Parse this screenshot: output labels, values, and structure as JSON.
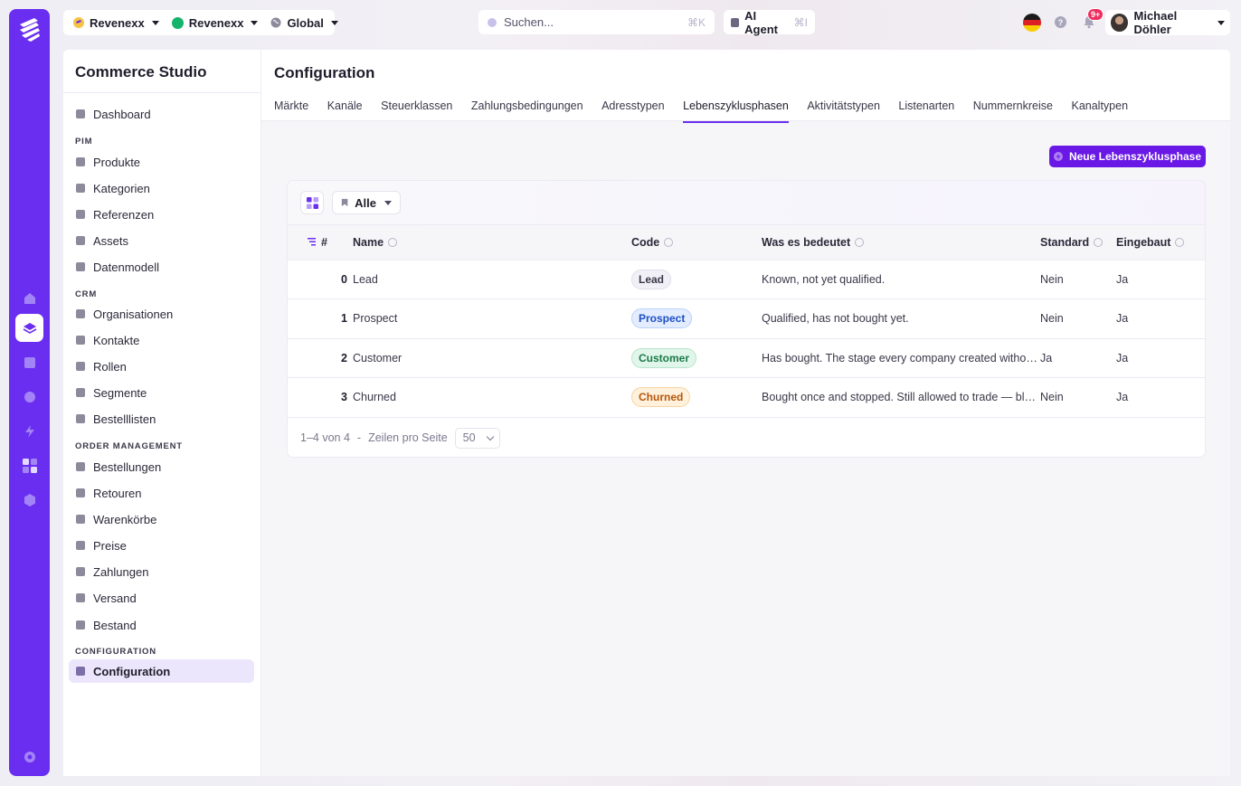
{
  "topbar": {
    "contexts": [
      {
        "label": "Revenexx",
        "icon": "brand-mini-icon"
      },
      {
        "label": "Revenexx",
        "icon": "green-dot-icon"
      },
      {
        "label": "Global",
        "icon": "globe-icon"
      }
    ],
    "search": {
      "placeholder": "Suchen...",
      "shortcut": "⌘K"
    },
    "agent": {
      "label": "AI Agent",
      "shortcut": "⌘I"
    },
    "notifications_badge": "9+",
    "user_name": "Michael Döhler"
  },
  "sidebar": {
    "app_title": "Commerce Studio",
    "dashboard": "Dashboard",
    "sections": [
      {
        "title": "PIM",
        "items": [
          "Produkte",
          "Kategorien",
          "Referenzen",
          "Assets",
          "Datenmodell"
        ]
      },
      {
        "title": "CRM",
        "items": [
          "Organisationen",
          "Kontakte",
          "Rollen",
          "Segmente",
          "Bestelllisten"
        ]
      },
      {
        "title": "ORDER MANAGEMENT",
        "items": [
          "Bestellungen",
          "Retouren",
          "Warenkörbe",
          "Preise",
          "Zahlungen",
          "Versand",
          "Bestand"
        ]
      },
      {
        "title": "CONFIGURATION",
        "items": [
          "Configuration"
        ]
      }
    ],
    "active_item": "Configuration"
  },
  "main": {
    "title": "Configuration",
    "tabs": [
      "Märkte",
      "Kanäle",
      "Steuerklassen",
      "Zahlungsbedingungen",
      "Adresstypen",
      "Lebenszyklusphasen",
      "Aktivitätstypen",
      "Listenarten",
      "Nummernkreise",
      "Kanaltypen"
    ],
    "active_tab": "Lebenszyklusphasen",
    "new_button": "Neue Lebenszyklusphase",
    "filter_label": "Alle",
    "table": {
      "columns": [
        "#",
        "Name",
        "Code",
        "Was es bedeutet",
        "Standard",
        "Eingebaut"
      ],
      "rows": [
        {
          "idx": "0",
          "name": "Lead",
          "code": "Lead",
          "meaning": "Known, not yet qualified.",
          "standard": "Nein",
          "builtin": "Ja"
        },
        {
          "idx": "1",
          "name": "Prospect",
          "code": "Prospect",
          "meaning": "Qualified, has not bought yet.",
          "standard": "Nein",
          "builtin": "Ja"
        },
        {
          "idx": "2",
          "name": "Customer",
          "code": "Customer",
          "meaning": "Has bought. The stage every company created without…",
          "standard": "Ja",
          "builtin": "Ja"
        },
        {
          "idx": "3",
          "name": "Churned",
          "code": "Churned",
          "meaning": "Bought once and stopped. Still allowed to trade — bloc…",
          "standard": "Nein",
          "builtin": "Ja"
        }
      ]
    },
    "pagination": {
      "range": "1–4 von 4",
      "separator": "-",
      "rows_label": "Zeilen pro Seite",
      "rows_value": "50"
    }
  },
  "colors": {
    "brand": "#6a2ef0",
    "button": "#6a18e6",
    "pill_lead": "#f2f0f7",
    "pill_prospect": "#e3edff",
    "pill_customer": "#e1f6ea",
    "pill_churned": "#fff1dc"
  }
}
